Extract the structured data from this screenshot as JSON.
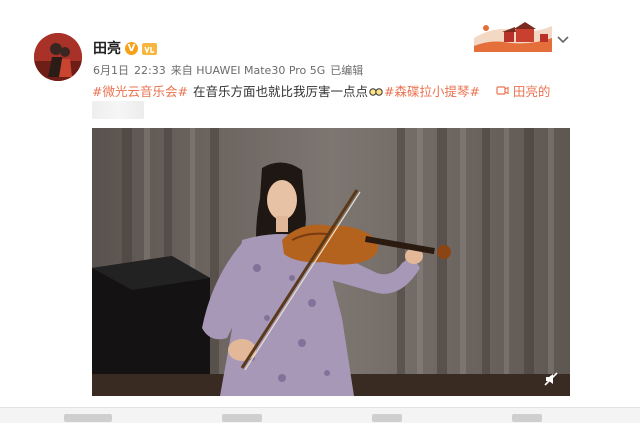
{
  "post": {
    "author": "田亮",
    "verified_badge": "V",
    "date": "6月1日",
    "time": "22:33",
    "source": "来自 HUAWEI Mate30 Pro 5G",
    "edited": "已编辑",
    "tag1": "#微光云音乐会#",
    "body_text": "在音乐方面也就比我厉害一点点",
    "tag2": "#森碟拉小提琴#",
    "video_link": "田亮的"
  },
  "colors": {
    "link": "#eb7350",
    "verified": "#f6a11b",
    "text": "#333333",
    "meta": "#6b6b6b"
  },
  "icons": {
    "verified": "verified-v-icon",
    "member": "member-level-icon",
    "emoji": "glasses-emoji-icon",
    "video": "video-link-icon",
    "chevron": "chevron-down-icon",
    "mute": "mute-icon"
  }
}
